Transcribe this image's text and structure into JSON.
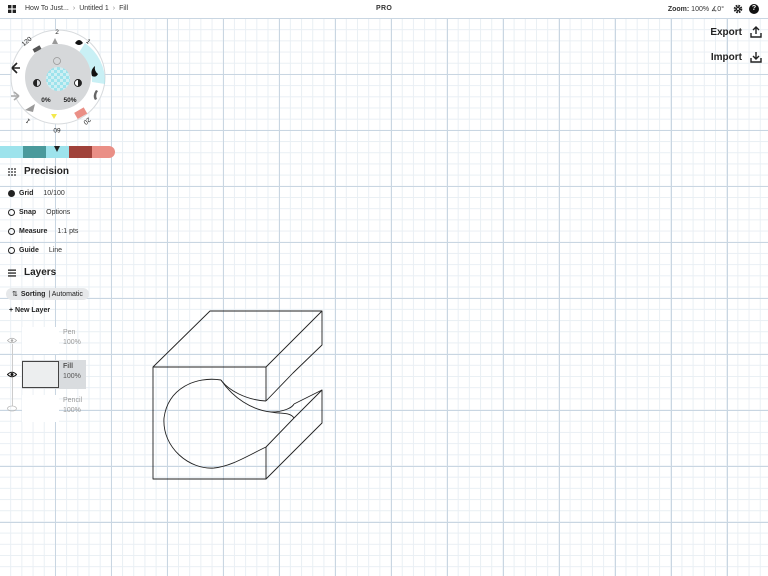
{
  "topbar": {
    "breadcrumbs": [
      "How To Just...",
      "Untitled 1",
      "Fill"
    ],
    "center_badge": "PRO",
    "zoom_label": "Zoom:",
    "zoom_value": "100%",
    "angle_value": "∡0°"
  },
  "actions": {
    "export_label": "Export",
    "import_label": "Import"
  },
  "tool_wheel": {
    "size_top": "2",
    "size_left": "120",
    "size_right": "1",
    "size_bottom": "60",
    "size_bottom_right": "20",
    "size_bottom_left": "1",
    "opacity_left": "0%",
    "opacity_right": "50%"
  },
  "colors": {
    "swatches": [
      "#9de3ec",
      "#4a9a9c",
      "#9de3ec",
      "#a0423a",
      "#ea8f86"
    ],
    "accent": "#9de3ec"
  },
  "precision": {
    "title": "Precision",
    "items": [
      {
        "label": "Grid",
        "value": "10/100",
        "on": true
      },
      {
        "label": "Snap",
        "value": "Options",
        "on": false
      },
      {
        "label": "Measure",
        "value": "1:1 pts",
        "on": false
      },
      {
        "label": "Guide",
        "value": "Line",
        "on": false
      }
    ]
  },
  "layers": {
    "title": "Layers",
    "sorting_label": "Sorting",
    "sorting_value": "| Automatic",
    "new_layer_label": "New Layer",
    "items": [
      {
        "name": "Pen",
        "opacity": "100%"
      },
      {
        "name": "Fill",
        "opacity": "100%"
      },
      {
        "name": "Pencil",
        "opacity": "100%"
      }
    ]
  }
}
